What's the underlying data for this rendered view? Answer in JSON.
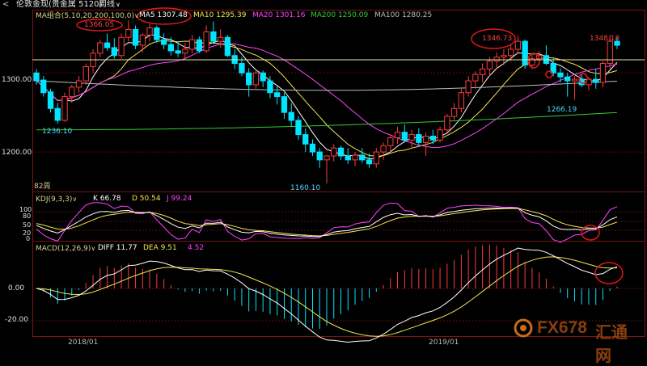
{
  "window": {
    "back_glyph": "<",
    "instrument": "伦敦金现(贵金属 5120)",
    "period": "周线",
    "dropdown_glyph": "∨"
  },
  "main_panel": {
    "ma_group_label": "MA组合(5,10,20,200,100,0)",
    "ma5": "MA5 1307.48",
    "ma10": "MA10 1295.39",
    "ma20": "MA20 1301.16",
    "ma200": "MA200 1250.09",
    "ma100": "MA100 1280.25",
    "period_count": "82周",
    "y_ticks": [
      "1300.00",
      "1200.00"
    ],
    "price_labels": {
      "high_2018": "1366.05",
      "low_2018a": "1236.10",
      "low_2018b": "1160.10",
      "high_2019": "1346.73",
      "low_2019": "1266.19",
      "last_high": "1348.18"
    }
  },
  "kdj_panel": {
    "label": "KDJ(9,3,3)",
    "k": "K 66.78",
    "d": "D 50.54",
    "j": "J 99.24",
    "y_ticks": [
      "100",
      "80",
      "50",
      "20",
      "0"
    ]
  },
  "macd_panel": {
    "label": "MACD(12,26,9)",
    "diff": "DIFF 11.77",
    "dea": "DEA 9.51",
    "macd": "4.52",
    "y_ticks": [
      "0.00",
      "-20.00"
    ]
  },
  "x_axis": {
    "ticks": [
      "2018/01",
      "2019/01"
    ]
  },
  "watermark": {
    "brand": "FX678",
    "cn": "汇通网"
  },
  "colors": {
    "up": "#ff3b3b",
    "down": "#00e5ff",
    "ma5": "#ffffff",
    "ma10": "#f2e64d",
    "ma20": "#ff44ff",
    "ma200": "#33cc33",
    "ma100": "#bbbbbb",
    "annotation": "#e01818"
  },
  "chart_data": {
    "type": "candlestick",
    "period": "weekly",
    "ylim": [
      1150,
      1380
    ],
    "ohlc": [
      [
        1300,
        1305,
        1285,
        1290
      ],
      [
        1291,
        1296,
        1270,
        1275
      ],
      [
        1276,
        1280,
        1250,
        1255
      ],
      [
        1255,
        1262,
        1236.1,
        1240
      ],
      [
        1240,
        1275,
        1238,
        1270
      ],
      [
        1270,
        1285,
        1262,
        1282
      ],
      [
        1282,
        1296,
        1275,
        1290
      ],
      [
        1290,
        1312,
        1285,
        1308
      ],
      [
        1308,
        1330,
        1300,
        1325
      ],
      [
        1325,
        1342,
        1320,
        1338
      ],
      [
        1338,
        1350,
        1328,
        1332
      ],
      [
        1332,
        1344,
        1318,
        1322
      ],
      [
        1322,
        1350,
        1318,
        1345
      ],
      [
        1345,
        1366.05,
        1340,
        1355
      ],
      [
        1355,
        1360,
        1330,
        1335
      ],
      [
        1335,
        1350,
        1326,
        1348
      ],
      [
        1348,
        1362,
        1340,
        1357
      ],
      [
        1357,
        1360,
        1338,
        1342
      ],
      [
        1342,
        1350,
        1330,
        1336
      ],
      [
        1336,
        1345,
        1322,
        1328
      ],
      [
        1328,
        1340,
        1320,
        1325
      ],
      [
        1325,
        1338,
        1318,
        1330
      ],
      [
        1330,
        1348,
        1325,
        1342
      ],
      [
        1342,
        1346,
        1325,
        1328
      ],
      [
        1328,
        1360,
        1325,
        1352
      ],
      [
        1352,
        1365,
        1336,
        1340
      ],
      [
        1340,
        1355,
        1332,
        1345
      ],
      [
        1345,
        1348,
        1320,
        1322
      ],
      [
        1322,
        1330,
        1305,
        1312
      ],
      [
        1312,
        1320,
        1296,
        1300
      ],
      [
        1300,
        1306,
        1270,
        1285
      ],
      [
        1285,
        1304,
        1280,
        1300
      ],
      [
        1300,
        1303,
        1282,
        1290
      ],
      [
        1290,
        1296,
        1268,
        1275
      ],
      [
        1275,
        1285,
        1260,
        1270
      ],
      [
        1270,
        1275,
        1242,
        1250
      ],
      [
        1250,
        1262,
        1232,
        1240
      ],
      [
        1240,
        1245,
        1215,
        1222
      ],
      [
        1222,
        1230,
        1200,
        1210
      ],
      [
        1210,
        1216,
        1195,
        1200
      ],
      [
        1200,
        1205,
        1180,
        1190
      ],
      [
        1190,
        1196,
        1160.1,
        1195
      ],
      [
        1195,
        1210,
        1188,
        1205
      ],
      [
        1205,
        1208,
        1190,
        1195
      ],
      [
        1195,
        1205,
        1185,
        1190
      ],
      [
        1190,
        1200,
        1182,
        1196
      ],
      [
        1196,
        1205,
        1186,
        1190
      ],
      [
        1190,
        1198,
        1180,
        1185
      ],
      [
        1185,
        1205,
        1180,
        1200
      ],
      [
        1200,
        1212,
        1190,
        1208
      ],
      [
        1208,
        1222,
        1200,
        1218
      ],
      [
        1218,
        1232,
        1210,
        1225
      ],
      [
        1225,
        1235,
        1212,
        1215
      ],
      [
        1215,
        1228,
        1205,
        1222
      ],
      [
        1222,
        1230,
        1208,
        1212
      ],
      [
        1212,
        1225,
        1195,
        1220
      ],
      [
        1220,
        1228,
        1210,
        1215
      ],
      [
        1215,
        1232,
        1212,
        1228
      ],
      [
        1228,
        1248,
        1225,
        1245
      ],
      [
        1245,
        1262,
        1240,
        1255
      ],
      [
        1255,
        1280,
        1250,
        1275
      ],
      [
        1275,
        1296,
        1270,
        1290
      ],
      [
        1290,
        1302,
        1280,
        1298
      ],
      [
        1298,
        1312,
        1288,
        1305
      ],
      [
        1305,
        1320,
        1296,
        1315
      ],
      [
        1315,
        1326,
        1305,
        1320
      ],
      [
        1320,
        1330,
        1310,
        1322
      ],
      [
        1322,
        1335,
        1315,
        1330
      ],
      [
        1330,
        1346.73,
        1325,
        1340
      ],
      [
        1340,
        1342,
        1305,
        1310
      ],
      [
        1310,
        1325,
        1305,
        1318
      ],
      [
        1318,
        1328,
        1310,
        1322
      ],
      [
        1322,
        1335,
        1310,
        1312
      ],
      [
        1312,
        1318,
        1296,
        1300
      ],
      [
        1300,
        1306,
        1288,
        1295
      ],
      [
        1295,
        1300,
        1270,
        1290
      ],
      [
        1290,
        1296,
        1266.19,
        1292
      ],
      [
        1292,
        1298,
        1282,
        1285
      ],
      [
        1285,
        1295,
        1278,
        1292
      ],
      [
        1292,
        1305,
        1280,
        1288
      ],
      [
        1288,
        1315,
        1282,
        1312
      ],
      [
        1312,
        1348.18,
        1305,
        1340
      ],
      [
        1340,
        1345,
        1330,
        1335
      ]
    ]
  }
}
